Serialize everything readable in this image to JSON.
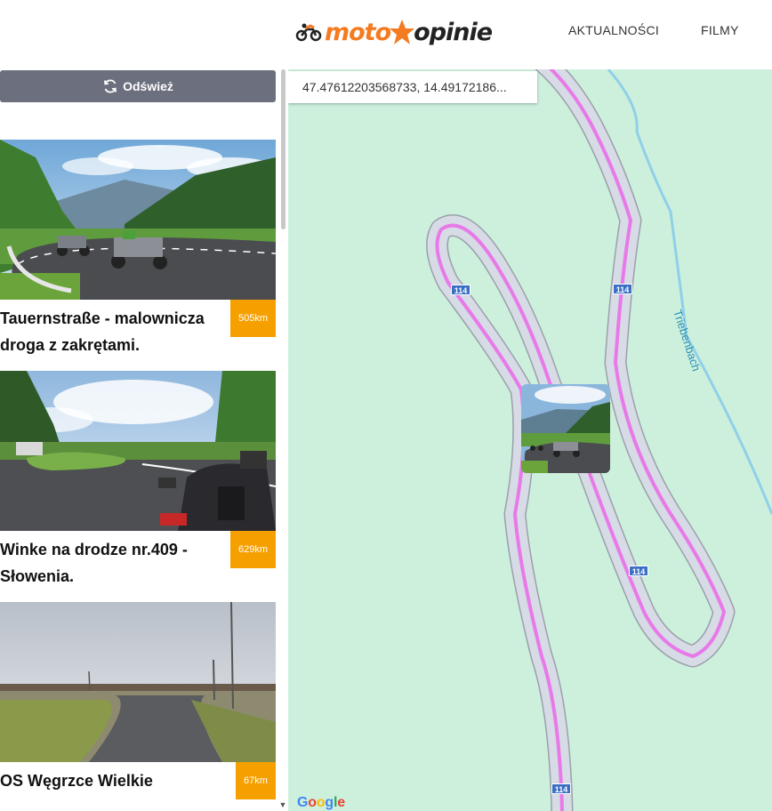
{
  "header": {
    "logo_left": "moto",
    "logo_right": "opinie",
    "nav": [
      "AKTUALNOŚCI",
      "FILMY"
    ]
  },
  "sidebar": {
    "refresh_label": "Odśwież",
    "cards": [
      {
        "title": "Tauernstraße - malownicza droga z zakrętami.",
        "distance": "505km"
      },
      {
        "title": "Winke na drodze nr.409 - Słowenia.",
        "distance": "629km"
      },
      {
        "title": "OS Węgrzce Wielkie",
        "distance": "67km"
      }
    ]
  },
  "map": {
    "coordinates": "47.47612203568733, 14.49172186...",
    "water_label": "Triebenbach",
    "road_number": "114",
    "attribution": "Google"
  },
  "colors": {
    "accent": "#f6a000",
    "logo_orange": "#f47b20",
    "button_gray": "#6c6f7d",
    "map_bg": "#cdf0dd",
    "route_pink": "#e879e8",
    "badge_blue": "#3a6fc4"
  }
}
